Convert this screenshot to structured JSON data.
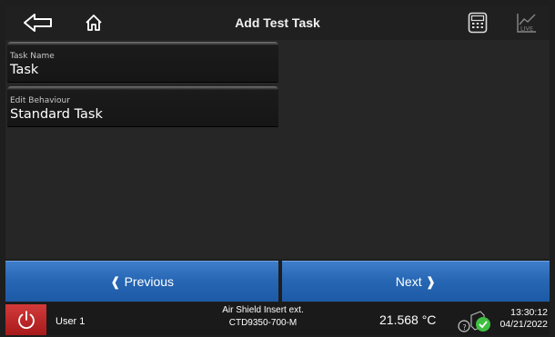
{
  "header": {
    "title": "Add Test Task",
    "icons": [
      "back-arrow-icon",
      "home-icon",
      "calculator-icon",
      "live-chart-icon"
    ],
    "live_label": "LIVE"
  },
  "fields": [
    {
      "label": "Task Name",
      "value": "Task"
    },
    {
      "label": "Edit Behaviour",
      "value": "Standard Task"
    }
  ],
  "nav": {
    "previous_label": "❰ Previous",
    "next_label": "Next ❱"
  },
  "status": {
    "user": "User 1",
    "device_line1": "Air Shield Insert ext.",
    "device_line2": "CTD9350-700-M",
    "temperature": "21.568 °C",
    "time": "13:30:12",
    "date": "04/21/2022"
  },
  "colors": {
    "accent_blue": "#2767b4",
    "power_red": "#c62828",
    "ok_green": "#3fbf3f"
  }
}
